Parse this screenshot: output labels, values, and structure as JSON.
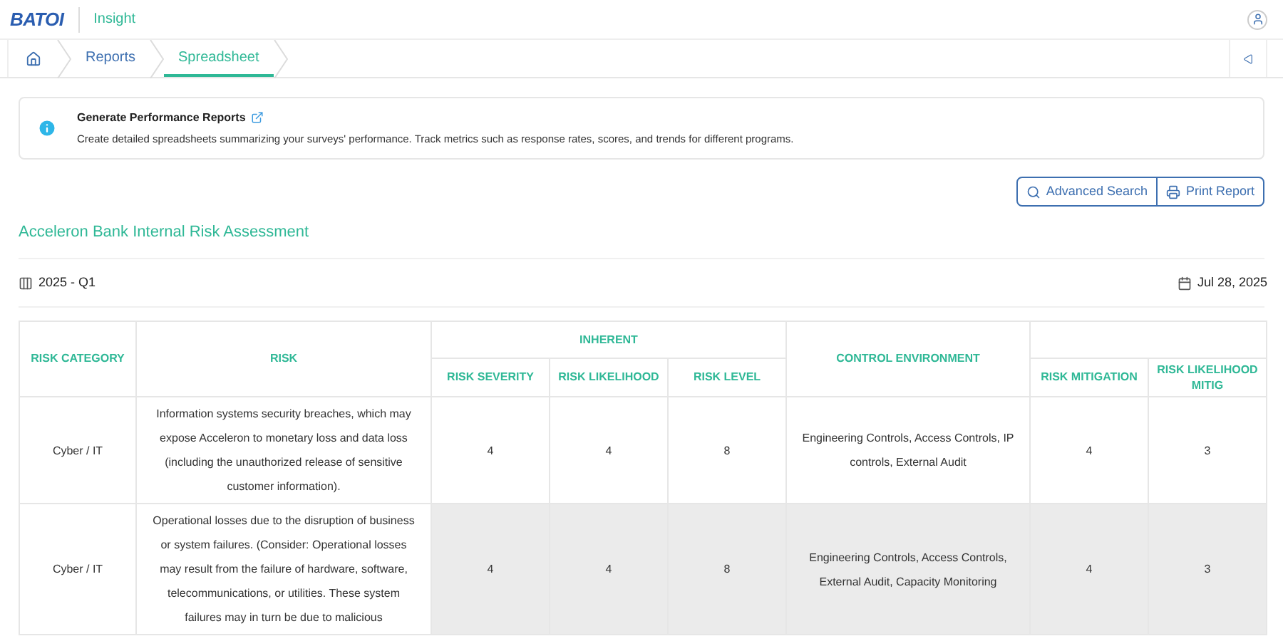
{
  "header": {
    "logo": "BATOI",
    "app_name": "Insight"
  },
  "breadcrumbs": [
    {
      "label": "Reports",
      "selected": false
    },
    {
      "label": "Spreadsheet",
      "selected": true
    }
  ],
  "info": {
    "title": "Generate Performance Reports",
    "text": "Create detailed spreadsheets summarizing your surveys' performance. Track metrics such as response rates, scores, and trends for different programs."
  },
  "actions": [
    {
      "kind": "search",
      "label": "Advanced Search"
    },
    {
      "kind": "print",
      "label": "Print Report"
    }
  ],
  "report": {
    "title": "Acceleron Bank Internal Risk Assessment",
    "period": "2025 - Q1",
    "date": "Jul 28, 2025"
  },
  "table": {
    "group_headers": [
      "INHERENT"
    ],
    "columns": [
      "RISK CATEGORY",
      "RISK",
      "RISK SEVERITY",
      "RISK LIKELIHOOD",
      "RISK LEVEL",
      "CONTROL ENVIRONMENT",
      "RISK MITIGATION",
      "RISK LIKELIHOOD MITIG"
    ],
    "rows": [
      {
        "highlighted": false,
        "cells": [
          "Cyber / IT",
          "Information systems security breaches, which may expose Acceleron to monetary loss and data loss (including the unauthorized release of sensitive customer information).",
          "4",
          "4",
          "8",
          "Engineering Controls, Access Controls, IP controls, External Audit",
          "4",
          "3"
        ]
      },
      {
        "highlighted": true,
        "cells": [
          "Cyber / IT",
          "Operational losses due to the disruption of business or system failures. (Consider: Operational losses may result from the failure of hardware, software, telecommunications, or utilities. These system failures may in turn be due to malicious",
          "4",
          "4",
          "8",
          "Engineering Controls, Access Controls, External Audit, Capacity Monitoring",
          "4",
          "3"
        ]
      }
    ]
  }
}
